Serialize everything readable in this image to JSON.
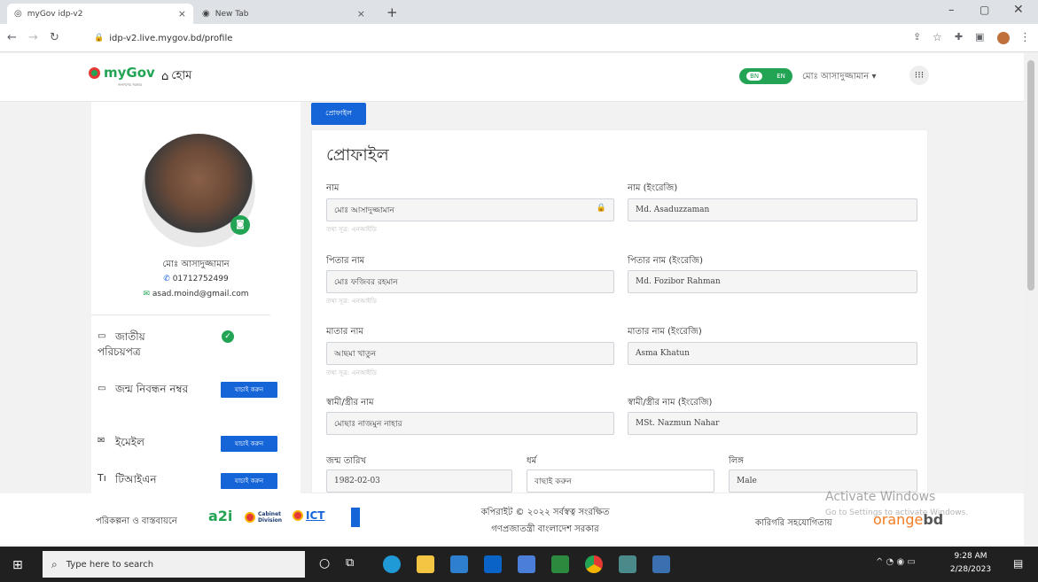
{
  "browser": {
    "tabs": [
      {
        "title": "myGov idp-v2",
        "close": "×"
      },
      {
        "title": "New Tab",
        "close": "×"
      }
    ],
    "new_tab": "+",
    "url": "idp-v2.live.mygov.bd/profile"
  },
  "header": {
    "logo_text": "myGov",
    "logo_sub": "জনগণের সরকার",
    "home_label": "হোম",
    "lang_toggle": {
      "bn": "BN",
      "en": "EN"
    },
    "user_name": "মোঃ আসাদুজ্জামান",
    "user_caret": "▾"
  },
  "sidebar": {
    "name": "মোঃ আসাদুজ্জামান",
    "phone": "01712752499",
    "email": "asad.moind@gmail.com",
    "items": [
      {
        "label": "জাতীয় পরিচয়পত্র",
        "status": "verified"
      },
      {
        "label": "জন্ম নিবন্ধন নম্বর",
        "action": "যাচাই করুন"
      },
      {
        "label": "ইমেইল",
        "action": "যাচাই করুন"
      },
      {
        "label": "টিআইএন",
        "action": "যাচাই করুন"
      }
    ]
  },
  "main": {
    "tab_label": "প্রোফাইল",
    "title": "প্রোফাইল",
    "source_hint": "তথ্য সূত্র: এনআইডি",
    "fields": {
      "name_bn": {
        "label": "নাম",
        "value": "মোঃ আসাদুজ্জামান"
      },
      "name_en": {
        "label": "নাম (ইংরেজি)",
        "value": "Md. Asaduzzaman"
      },
      "father_bn": {
        "label": "পিতার নাম",
        "value": "মোঃ ফজিবর রহমান"
      },
      "father_en": {
        "label": "পিতার নাম (ইংরেজি)",
        "value": "Md. Fozibor Rahman"
      },
      "mother_bn": {
        "label": "মাতার নাম",
        "value": "আছমা খাতুন"
      },
      "mother_en": {
        "label": "মাতার নাম (ইংরেজি)",
        "value": "Asma Khatun"
      },
      "spouse_bn": {
        "label": "স্বামী/স্ত্রীর নাম",
        "value": "মোছাঃ নাজমুন নাহার"
      },
      "spouse_en": {
        "label": "স্বামী/স্ত্রীর নাম (ইংরেজি)",
        "value": "MSt. Nazmun Nahar"
      },
      "dob": {
        "label": "জন্ম তারিখ",
        "value": "1982-02-03"
      },
      "religion": {
        "label": "ধর্ম",
        "placeholder": "বাছাই করুন"
      },
      "gender": {
        "label": "লিঙ্গ",
        "value": "Male"
      }
    }
  },
  "footer": {
    "planning": "পরিকল্পনা ও বাস্তবায়নে",
    "a2i": "a2i",
    "cabinet": "Cabinet Division",
    "ict": "ICT",
    "copyright": "কপিরাইট © ২০২২ সর্বস্বত্ব সংরক্ষিত",
    "govt": "গণপ্রজাতন্ত্রী বাংলাদেশ সরকার",
    "tech_support": "কারিগরি সহযোগিতায়",
    "orange": "orange",
    "bd": "bd",
    "watermark_title": "Activate Windows",
    "watermark_sub": "Go to Settings to activate Windows."
  },
  "taskbar": {
    "search_placeholder": "Type here to search",
    "time": "9:28 AM",
    "date": "2/28/2023"
  },
  "colors": {
    "primary": "#1565d8",
    "green": "#23a455",
    "orange": "#f47b20"
  }
}
